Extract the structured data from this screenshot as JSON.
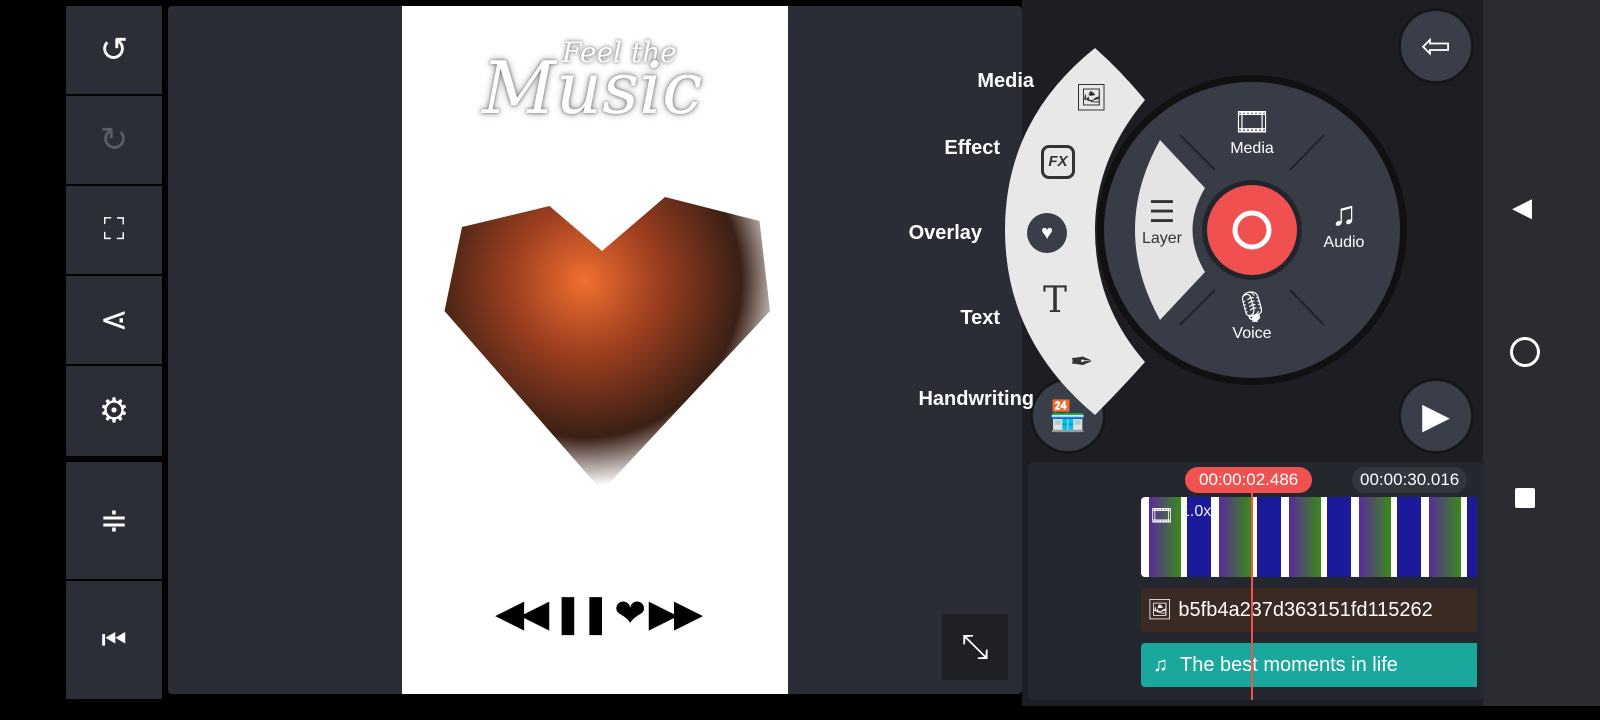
{
  "toolbar": {
    "items": [
      {
        "name": "undo",
        "icon": "undo-icon",
        "glyph": "↺"
      },
      {
        "name": "redo",
        "icon": "redo-icon",
        "glyph": "↻"
      },
      {
        "name": "fullscreen",
        "icon": "fullscreen-icon",
        "glyph": "⛶"
      },
      {
        "name": "share",
        "icon": "share-icon",
        "glyph": "⋖"
      },
      {
        "name": "settings",
        "icon": "gear-icon",
        "glyph": "⚙"
      },
      {
        "name": "adjust",
        "icon": "adjust-icon",
        "glyph": "≑"
      },
      {
        "name": "go-start",
        "icon": "skip-start-icon",
        "glyph": "⏮"
      }
    ]
  },
  "preview": {
    "title_small": "Feel the",
    "title_big": "Music",
    "player_controls": "◀◀ ❚❚ ❤ ▶▶"
  },
  "arc_menu": {
    "items": [
      {
        "label": "Media",
        "glyph": "🖼"
      },
      {
        "label": "Effect",
        "glyph": "FX"
      },
      {
        "label": "Overlay",
        "glyph": "♥"
      },
      {
        "label": "Text",
        "glyph": "T"
      },
      {
        "label": "Handwriting",
        "glyph": "✒"
      }
    ]
  },
  "wheel": {
    "media": "Media",
    "audio": "Audio",
    "voice": "Voice",
    "layer": "Layer",
    "accent": "#f0504f"
  },
  "timeline": {
    "current_time": "00:00:02.486",
    "total_time": "00:00:30.016",
    "video_speed": "1.0x",
    "layer_name": "b5fb4a237d363151fd115262",
    "audio_name": "The best moments in life"
  },
  "colors": {
    "playhead": "#f05252",
    "audio_track": "#1aa89c"
  }
}
